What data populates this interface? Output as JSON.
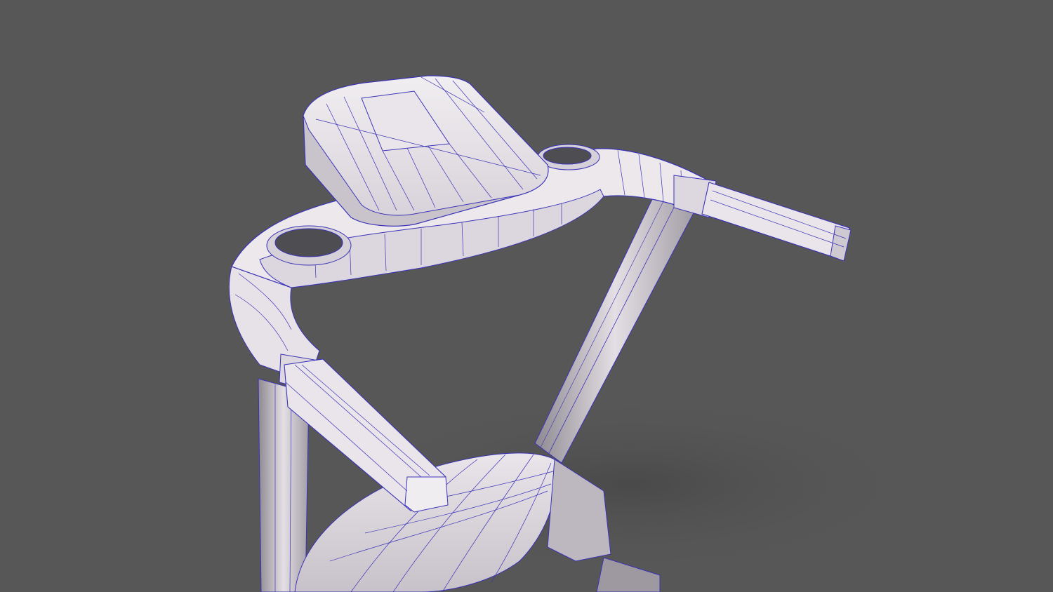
{
  "scene": {
    "subject": "treadmill-wireframe-render",
    "colors": {
      "background": "#575757",
      "surface": "#ece8ec",
      "surface_shade": "#c9c4cb",
      "surface_dark": "#a9a4ac",
      "wire": "#3b33b8",
      "shadow": "#4c4c4c"
    }
  }
}
